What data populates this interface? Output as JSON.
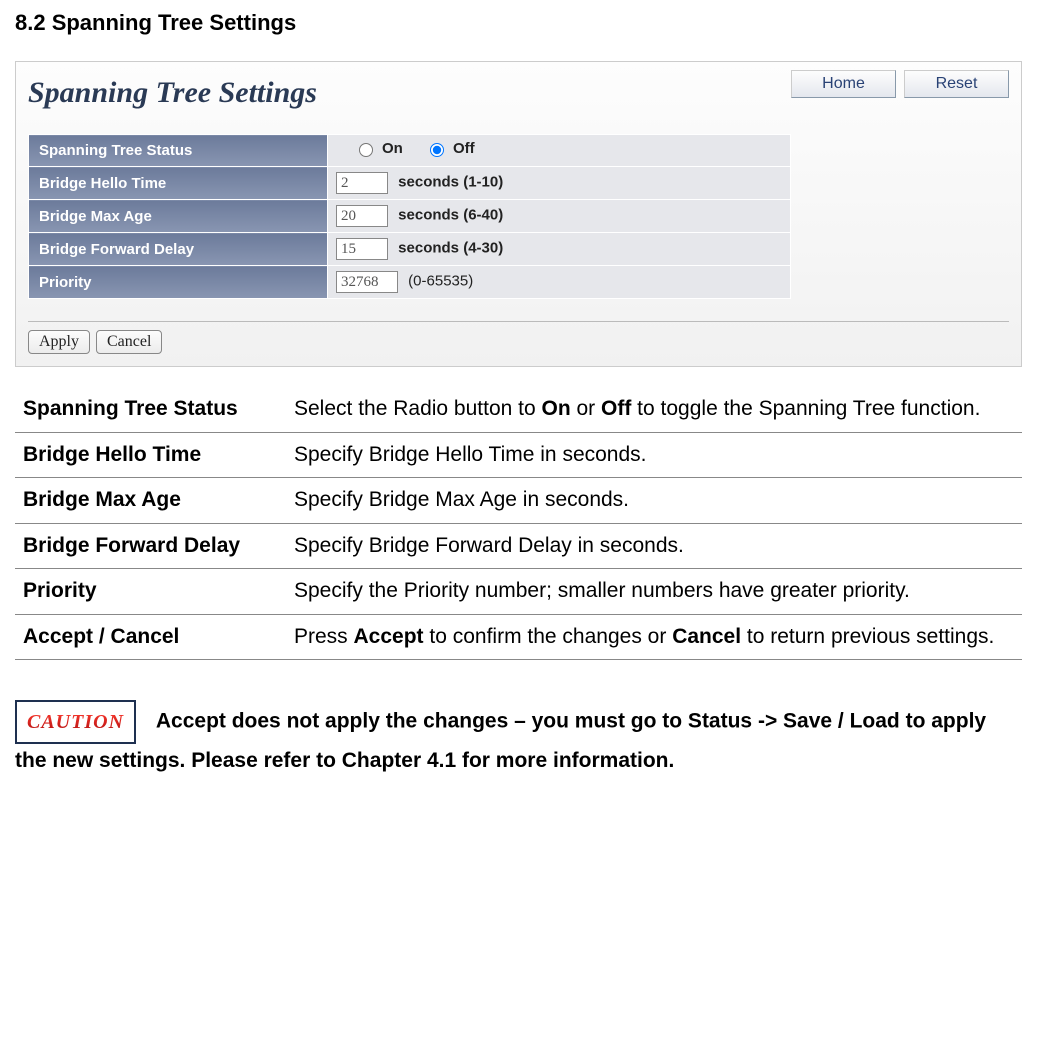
{
  "section_title": "8.2 Spanning Tree Settings",
  "panel": {
    "title": "Spanning Tree Settings",
    "buttons": {
      "home": "Home",
      "reset": "Reset"
    },
    "rows": {
      "status": {
        "label": "Spanning Tree Status",
        "option_on": "On",
        "option_off": "Off",
        "selected": "off"
      },
      "hello": {
        "label": "Bridge Hello Time",
        "value": "2",
        "suffix": "seconds (1-10)"
      },
      "maxage": {
        "label": "Bridge Max Age",
        "value": "20",
        "suffix": "seconds (6-40)"
      },
      "fwd": {
        "label": "Bridge Forward Delay",
        "value": "15",
        "suffix": "seconds (4-30)"
      },
      "priority": {
        "label": "Priority",
        "value": "32768",
        "suffix": "(0-65535)"
      }
    },
    "footer": {
      "apply": "Apply",
      "cancel": "Cancel"
    }
  },
  "desc": [
    {
      "label": "Spanning Tree Status",
      "parts": [
        "Select the Radio button to ",
        "On",
        " or ",
        "Off",
        " to toggle the Spanning Tree function."
      ]
    },
    {
      "label": "Bridge Hello Time",
      "parts": [
        "Specify Bridge Hello Time in seconds."
      ]
    },
    {
      "label": "Bridge Max Age",
      "parts": [
        "Specify Bridge Max Age in seconds."
      ]
    },
    {
      "label": "Bridge Forward Delay",
      "parts": [
        "Specify Bridge Forward Delay in seconds."
      ]
    },
    {
      "label": "Priority",
      "parts": [
        "Specify the Priority number; smaller numbers have greater priority."
      ]
    },
    {
      "label": "Accept / Cancel",
      "parts": [
        "Press ",
        "Accept",
        " to confirm the changes or ",
        "Cancel",
        " to return previous settings."
      ]
    }
  ],
  "caution": {
    "badge": "CAUTION",
    "text": "Accept does not apply the changes – you must go to Status -> Save / Load to apply the new settings. Please refer to Chapter 4.1 for more information."
  }
}
